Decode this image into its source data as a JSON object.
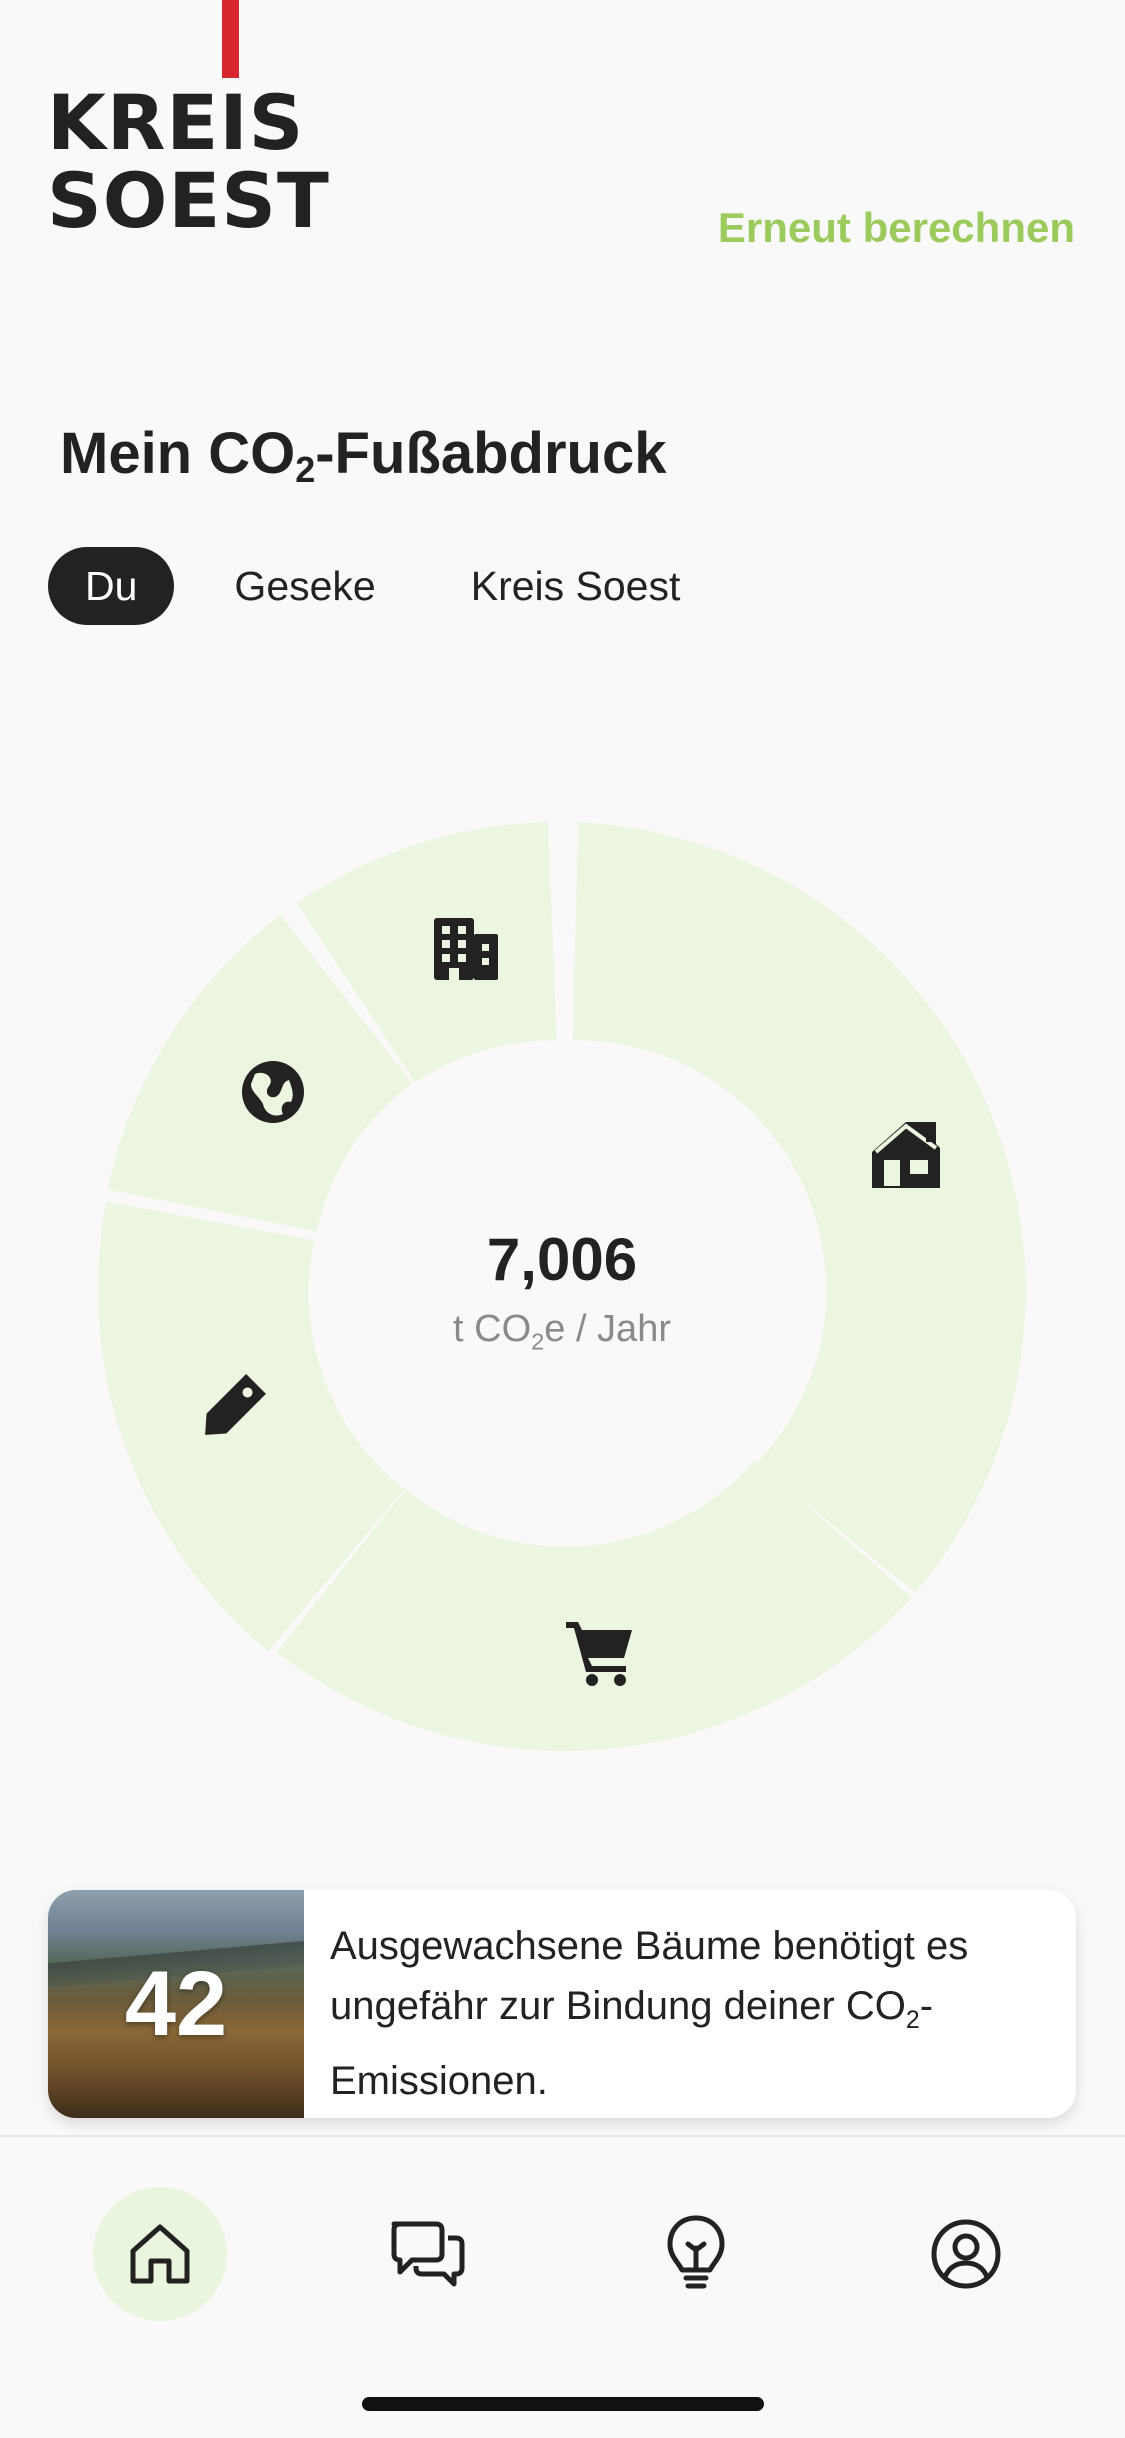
{
  "header": {
    "logo": {
      "line1": "KREIS",
      "line2": "SOEST"
    },
    "recalculate_label": "Erneut berechnen"
  },
  "title": {
    "prefix": "Mein CO",
    "sub": "2",
    "suffix": "-Fußabdruck"
  },
  "tabs": [
    {
      "label": "Du",
      "active": true
    },
    {
      "label": "Geseke",
      "active": false
    },
    {
      "label": "Kreis Soest",
      "active": false
    }
  ],
  "chart_data": {
    "type": "pie",
    "segments": [
      {
        "icon": "house-icon"
      },
      {
        "icon": "shopping-cart-icon"
      },
      {
        "icon": "price-tag-icon"
      },
      {
        "icon": "globe-icon"
      },
      {
        "icon": "building-icon"
      }
    ],
    "total": "7,006",
    "unit_prefix": "t CO",
    "unit_sub": "2",
    "unit_suffix": "e / Jahr",
    "segment_color": "#ebf5df"
  },
  "info_card": {
    "number": "42",
    "text_line1": "Ausgewachsene Bäume benötigt es ungefähr zur Bindung deiner CO",
    "text_sub": "2",
    "text_line2": "-Emissionen."
  },
  "nav": [
    {
      "icon": "home-icon",
      "active": true
    },
    {
      "icon": "chat-icon",
      "active": false
    },
    {
      "icon": "lightbulb-icon",
      "active": false
    },
    {
      "icon": "profile-icon",
      "active": false
    }
  ],
  "colors": {
    "accent": "#9ccb5d",
    "brand_red": "#d8262f",
    "dark": "#222222"
  }
}
